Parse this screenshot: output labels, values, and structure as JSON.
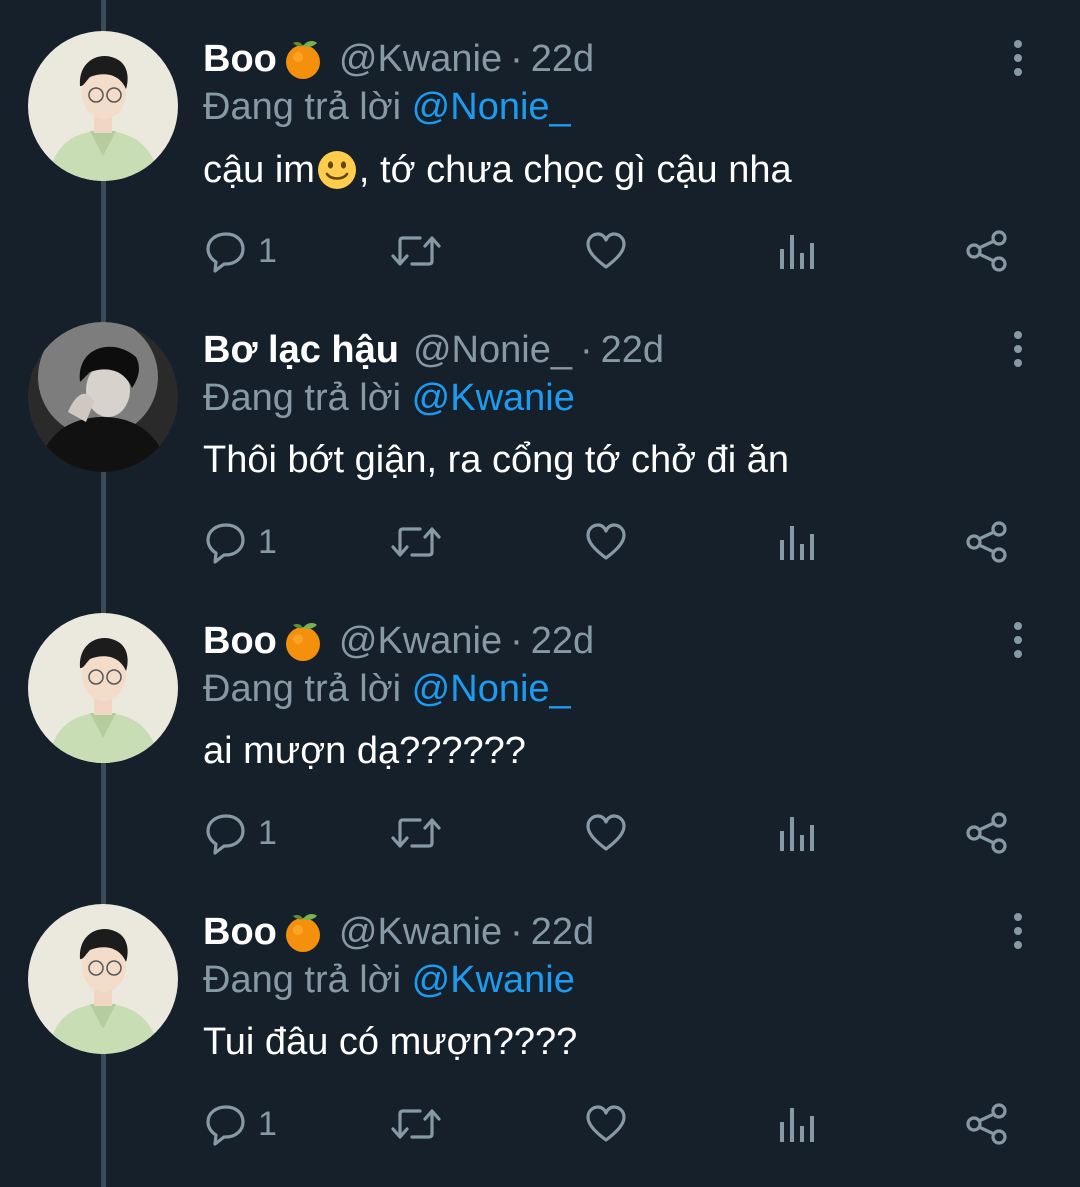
{
  "colors": {
    "background": "#15202b",
    "muted": "#8899a6",
    "mention": "#1d9bf0",
    "thread_line": "#3d4b58"
  },
  "reply_prefix": "Đang trả lời",
  "tweets": [
    {
      "name": "Boo",
      "name_emoji": "tangerine-emoji",
      "handle": "@Kwanie",
      "separator": "·",
      "time": "22d",
      "reply_to": "@Nonie_",
      "text_before": "cậu im",
      "text_emoji": "slightly-smiling-face-emoji",
      "text_after": ", tớ chưa chọc gì cậu nha",
      "reply_count": "1",
      "avatar": "light"
    },
    {
      "name": "Bơ lạc hậu",
      "name_emoji": "",
      "handle": "@Nonie_",
      "separator": "·",
      "time": "22d",
      "reply_to": "@Kwanie",
      "text_before": "Thôi bớt giận, ra cổng tớ chở đi ăn",
      "text_emoji": "",
      "text_after": "",
      "reply_count": "1",
      "avatar": "dark"
    },
    {
      "name": "Boo",
      "name_emoji": "tangerine-emoji",
      "handle": "@Kwanie",
      "separator": "·",
      "time": "22d",
      "reply_to": "@Nonie_",
      "text_before": "ai mượn dạ??????",
      "text_emoji": "",
      "text_after": "",
      "reply_count": "1",
      "avatar": "light"
    },
    {
      "name": "Boo",
      "name_emoji": "tangerine-emoji",
      "handle": "@Kwanie",
      "separator": "·",
      "time": "22d",
      "reply_to": "@Kwanie",
      "text_before": "Tui đâu có mượn????",
      "text_emoji": "",
      "text_after": "",
      "reply_count": "1",
      "avatar": "light"
    }
  ],
  "icons": [
    "reply-icon",
    "retweet-icon",
    "like-icon",
    "analytics-icon",
    "share-icon",
    "more-options-icon"
  ]
}
